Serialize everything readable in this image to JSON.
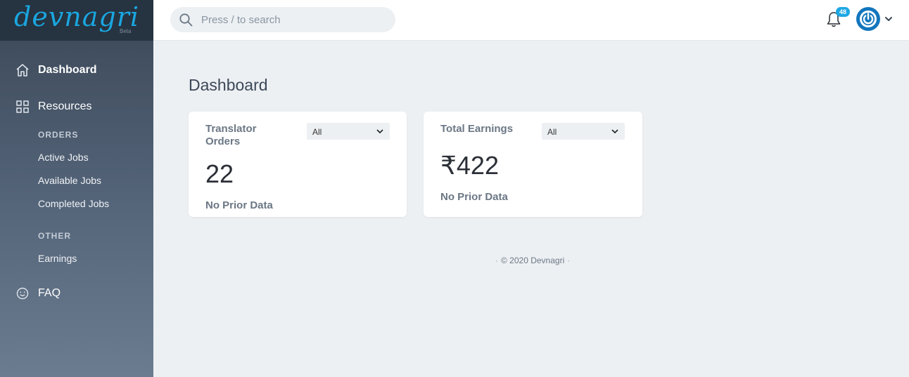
{
  "app": {
    "logo_text": "devnagri",
    "logo_badge": "Beta"
  },
  "sidebar": {
    "items": [
      {
        "label": "Dashboard",
        "icon": "home-icon"
      },
      {
        "label": "Resources",
        "icon": "grid-icon"
      }
    ],
    "sections": [
      {
        "header": "ORDERS",
        "items": [
          "Active Jobs",
          "Available Jobs",
          "Completed Jobs"
        ]
      },
      {
        "header": "OTHER",
        "items": [
          "Earnings"
        ]
      }
    ],
    "faq": {
      "label": "FAQ",
      "icon": "smiley-icon"
    }
  },
  "topbar": {
    "search_placeholder": "Press / to search",
    "notification_count": "48"
  },
  "main": {
    "title": "Dashboard",
    "cards": [
      {
        "title": "Translator Orders",
        "filter": "All",
        "value": "22",
        "note": "No Prior Data"
      },
      {
        "title": "Total Earnings",
        "filter": "All",
        "value": "₹422",
        "note": "No Prior Data"
      }
    ]
  },
  "footer": {
    "text": "© 2020 Devnagri"
  },
  "colors": {
    "accent": "#1ea7e4",
    "sidebar_top": "#3a4756",
    "sidebar_bottom": "#6b7c90",
    "background": "#edf0f3"
  }
}
